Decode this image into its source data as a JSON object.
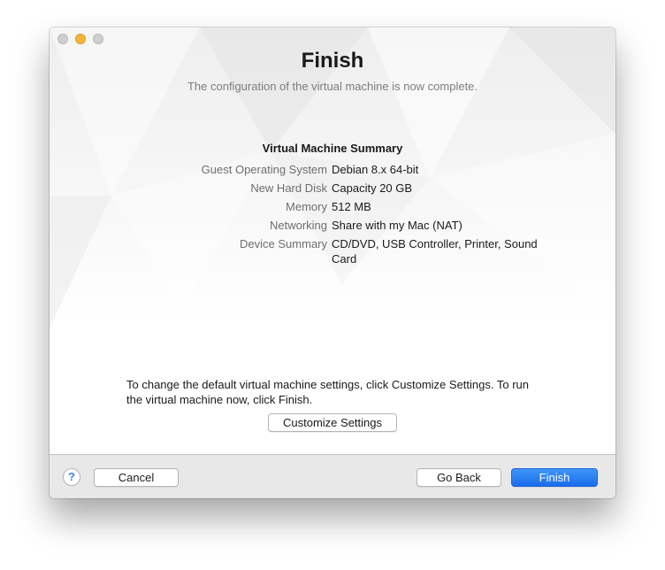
{
  "window": {
    "title": "Finish",
    "subtitle": "The configuration of the virtual machine is now complete."
  },
  "summary": {
    "heading": "Virtual Machine Summary",
    "rows": [
      {
        "label": "Guest Operating System",
        "value": "Debian 8.x 64-bit"
      },
      {
        "label": "New Hard Disk",
        "value": "Capacity 20 GB"
      },
      {
        "label": "Memory",
        "value": "512 MB"
      },
      {
        "label": "Networking",
        "value": "Share with my Mac (NAT)"
      },
      {
        "label": "Device Summary",
        "value": "CD/DVD, USB Controller, Printer, Sound Card"
      }
    ]
  },
  "hint": "To change the default virtual machine settings, click Customize Settings. To run the virtual machine now, click Finish.",
  "buttons": {
    "customize": "Customize Settings",
    "help": "?",
    "cancel": "Cancel",
    "go_back": "Go Back",
    "finish": "Finish"
  },
  "colors": {
    "accent": "#1a6cec",
    "minimize_light": "#f4b53c",
    "inactive_light": "#cfcfcf"
  },
  "icons": {
    "close": "close-icon",
    "minimize": "minimize-icon",
    "zoom": "zoom-icon",
    "help": "help-icon"
  }
}
